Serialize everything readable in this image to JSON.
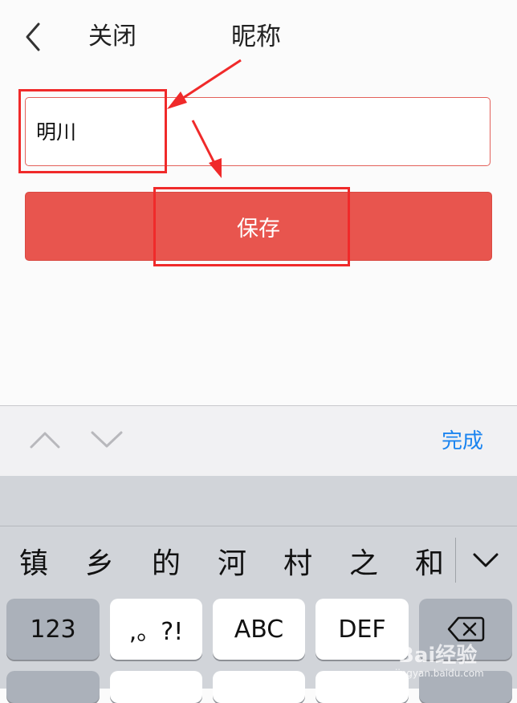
{
  "header": {
    "close_label": "关闭",
    "title": "昵称"
  },
  "nickname": {
    "value": "明川"
  },
  "save": {
    "label": "保存"
  },
  "toolbar": {
    "done_label": "完成"
  },
  "keyboard": {
    "candidates": [
      "镇",
      "乡",
      "的",
      "河",
      "村",
      "之",
      "和"
    ],
    "keys": {
      "numbers": "123",
      "punct": ",。?!",
      "abc": "ABC",
      "def": "DEF"
    }
  },
  "watermark": {
    "text": "Bai经验",
    "url": "jingyan.baidu.com"
  },
  "colors": {
    "accent": "#e8554e",
    "field_border": "#e3605a",
    "annotation": "#f02a2a",
    "done": "#1a84f0",
    "keyboard_bg": "#d1d4d9"
  }
}
